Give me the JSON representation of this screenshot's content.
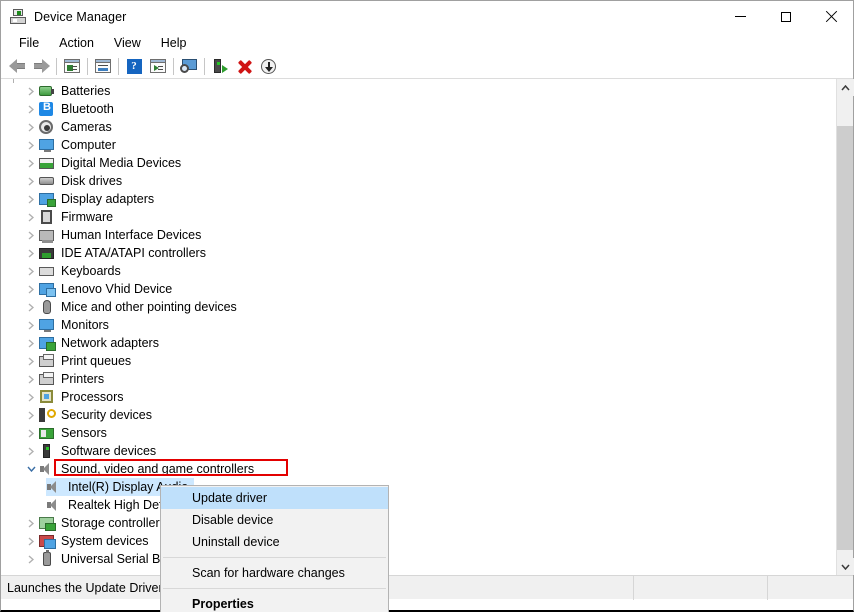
{
  "window": {
    "title": "Device Manager",
    "icon": "device-manager-icon",
    "minimize_label": "Minimize",
    "maximize_label": "Maximize",
    "close_label": "Close"
  },
  "menubar": {
    "items": [
      {
        "label": "File"
      },
      {
        "label": "Action"
      },
      {
        "label": "View"
      },
      {
        "label": "Help"
      }
    ]
  },
  "toolbar": {
    "items": [
      {
        "name": "back-arrow-icon"
      },
      {
        "name": "forward-arrow-icon"
      },
      {
        "name": "separator-1"
      },
      {
        "name": "show-hidden-devices-icon"
      },
      {
        "name": "separator-2"
      },
      {
        "name": "properties-icon"
      },
      {
        "name": "separator-3"
      },
      {
        "name": "help-icon",
        "glyph": "?"
      },
      {
        "name": "play-view-icon"
      },
      {
        "name": "separator-4"
      },
      {
        "name": "scan-for-hardware-changes-icon"
      },
      {
        "name": "separator-5"
      },
      {
        "name": "update-driver-icon"
      },
      {
        "name": "uninstall-device-icon"
      },
      {
        "name": "disable-device-icon"
      }
    ]
  },
  "tree": {
    "items": [
      {
        "label": "Batteries",
        "icon": "battery-icon",
        "level": 1,
        "expanded": false
      },
      {
        "label": "Bluetooth",
        "icon": "bluetooth-icon",
        "level": 1,
        "expanded": false
      },
      {
        "label": "Cameras",
        "icon": "camera-icon",
        "level": 1,
        "expanded": false
      },
      {
        "label": "Computer",
        "icon": "computer-icon",
        "level": 1,
        "expanded": false
      },
      {
        "label": "Digital Media Devices",
        "icon": "digital-media-icon",
        "level": 1,
        "expanded": false
      },
      {
        "label": "Disk drives",
        "icon": "disk-drive-icon",
        "level": 1,
        "expanded": false
      },
      {
        "label": "Display adapters",
        "icon": "display-adapter-icon",
        "level": 1,
        "expanded": false
      },
      {
        "label": "Firmware",
        "icon": "firmware-icon",
        "level": 1,
        "expanded": false
      },
      {
        "label": "Human Interface Devices",
        "icon": "hid-icon",
        "level": 1,
        "expanded": false
      },
      {
        "label": "IDE ATA/ATAPI controllers",
        "icon": "ide-controller-icon",
        "level": 1,
        "expanded": false
      },
      {
        "label": "Keyboards",
        "icon": "keyboard-icon",
        "level": 1,
        "expanded": false
      },
      {
        "label": "Lenovo Vhid Device",
        "icon": "lenovo-vhid-icon",
        "level": 1,
        "expanded": false
      },
      {
        "label": "Mice and other pointing devices",
        "icon": "mouse-icon",
        "level": 1,
        "expanded": false
      },
      {
        "label": "Monitors",
        "icon": "monitor-icon",
        "level": 1,
        "expanded": false
      },
      {
        "label": "Network adapters",
        "icon": "network-adapter-icon",
        "level": 1,
        "expanded": false
      },
      {
        "label": "Print queues",
        "icon": "print-queue-icon",
        "level": 1,
        "expanded": false
      },
      {
        "label": "Printers",
        "icon": "printer-icon",
        "level": 1,
        "expanded": false
      },
      {
        "label": "Processors",
        "icon": "processor-icon",
        "level": 1,
        "expanded": false
      },
      {
        "label": "Security devices",
        "icon": "security-device-icon",
        "level": 1,
        "expanded": false
      },
      {
        "label": "Sensors",
        "icon": "sensor-icon",
        "level": 1,
        "expanded": false
      },
      {
        "label": "Software devices",
        "icon": "software-device-icon",
        "level": 1,
        "expanded": false
      },
      {
        "label": "Sound, video and game controllers",
        "icon": "sound-controller-icon",
        "level": 1,
        "expanded": true,
        "highlighted": true
      },
      {
        "label": "Intel(R) Display Audio",
        "icon": "sound-device-icon",
        "level": 2,
        "selected": true
      },
      {
        "label": "Realtek High Definition Audio",
        "icon": "sound-device-icon",
        "level": 2
      },
      {
        "label": "Storage controllers",
        "icon": "storage-controller-icon",
        "level": 1,
        "expanded": false
      },
      {
        "label": "System devices",
        "icon": "system-device-icon",
        "level": 1,
        "expanded": false
      },
      {
        "label": "Universal Serial Bus controllers",
        "icon": "usb-controller-icon",
        "level": 1,
        "expanded": false
      }
    ]
  },
  "context_menu": {
    "items": [
      {
        "label": "Update driver",
        "highlighted": true,
        "separator_before": false
      },
      {
        "label": "Disable device",
        "highlighted": false,
        "separator_before": false
      },
      {
        "label": "Uninstall device",
        "highlighted": false,
        "separator_before": false
      },
      {
        "label": "Scan for hardware changes",
        "highlighted": false,
        "separator_before": true
      },
      {
        "label": "Properties",
        "highlighted": false,
        "separator_before": true,
        "bold": true
      }
    ]
  },
  "statusbar": {
    "message": "Launches the Update Driver Wizard.",
    "segment_two": "",
    "segment_three": ""
  },
  "scrollbar": {
    "up_label": "Scroll up",
    "down_label": "Scroll down",
    "thumb_label": "Vertical scroll thumb"
  },
  "colors": {
    "selection_blue": "#cde8ff",
    "menu_highlight_blue": "#bfe0fb",
    "annotation_red": "#e30000",
    "statusbar_bg": "#f0f0f0"
  }
}
